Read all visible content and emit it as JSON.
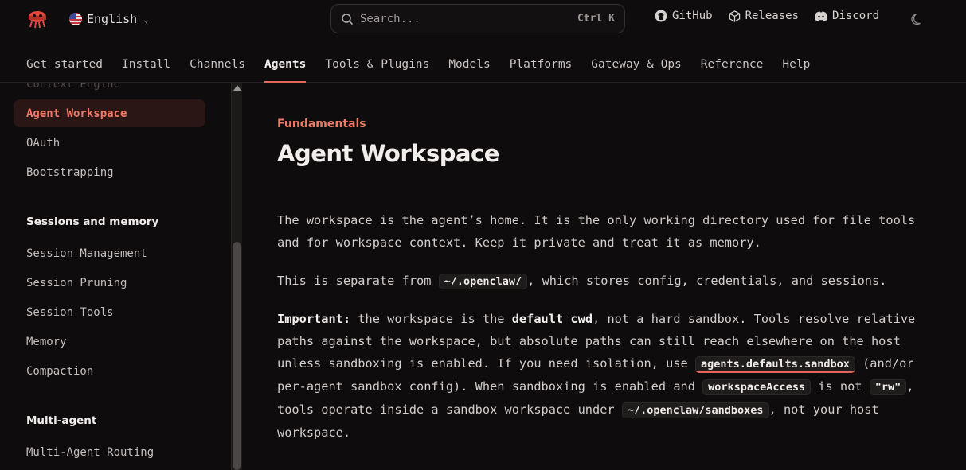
{
  "header": {
    "language": "English",
    "search_placeholder": "Search...",
    "search_shortcut": "Ctrl K",
    "links": [
      {
        "label": "GitHub",
        "icon": "github-icon"
      },
      {
        "label": "Releases",
        "icon": "package-icon"
      },
      {
        "label": "Discord",
        "icon": "discord-icon"
      }
    ],
    "theme_icon": "moon-icon"
  },
  "tabs": [
    "Get started",
    "Install",
    "Channels",
    "Agents",
    "Tools & Plugins",
    "Models",
    "Platforms",
    "Gateway & Ops",
    "Reference",
    "Help"
  ],
  "active_tab": "Agents",
  "sidebar": {
    "partial_item": "Context Engine",
    "items_top": [
      "Agent Workspace",
      "OAuth",
      "Bootstrapping"
    ],
    "active_item": "Agent Workspace",
    "groups": [
      {
        "title": "Sessions and memory",
        "items": [
          "Session Management",
          "Session Pruning",
          "Session Tools",
          "Memory",
          "Compaction"
        ]
      },
      {
        "title": "Multi-agent",
        "items": [
          "Multi-Agent Routing"
        ]
      }
    ]
  },
  "content": {
    "eyebrow": "Fundamentals",
    "title": "Agent Workspace",
    "p1": "The workspace is the agent’s home. It is the only working directory used for file tools and for workspace context. Keep it private and treat it as memory.",
    "p2_before": "This is separate from ",
    "p2_code": "~/.openclaw/",
    "p2_after": ", which stores config, credentials, and sessions.",
    "p3_strong": "Important:",
    "p3_a": " the workspace is the ",
    "p3_bold": "default cwd",
    "p3_b": ", not a hard sandbox. Tools resolve relative paths against the workspace, but absolute paths can still reach elsewhere on the host unless sandboxing is enabled. If you need isolation, use ",
    "p3_code1": "agents.defaults.sandbox",
    "p3_c": " (and/or per-agent sandbox config). When sandboxing is enabled and ",
    "p3_code2": "workspaceAccess",
    "p3_d": " is not ",
    "p3_code3": "\"rw\"",
    "p3_e": ", tools operate inside a sandbox workspace under ",
    "p3_code4": "~/.openclaw/sandboxes",
    "p3_f": ", not your host workspace."
  },
  "colors": {
    "accent": "#f07a66",
    "background": "#0e0c0c"
  }
}
